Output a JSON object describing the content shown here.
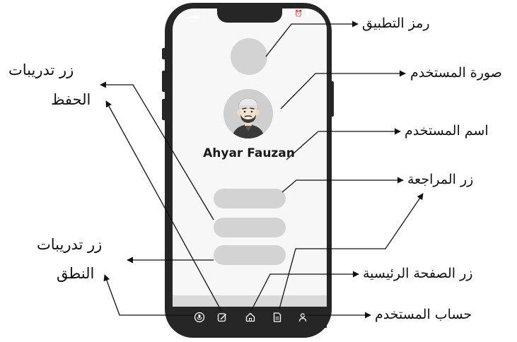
{
  "phone": {
    "user_name": "Ahyar Fauzan"
  },
  "labels": {
    "app_icon": "رمز التطبيق",
    "user_photo": "صورة المستخدم",
    "user_name": "اسم المستخدم",
    "review_button": "زر المراجعة",
    "home_button": "زر الصفحة الرئيسية",
    "user_account": "حساب المستخدم",
    "memorization_training_line1": "زر تدريبات",
    "memorization_training_line2": "الحفظ",
    "pronunciation_training_line1": "زر تدريبات",
    "pronunciation_training_line2": "النطق"
  },
  "nav_icons": [
    "mic-icon",
    "edit-icon",
    "home-icon",
    "document-icon",
    "user-icon"
  ],
  "colors": {
    "phone_body": "#262626",
    "screen": "#f7f7f7",
    "placeholder": "#d3d3d3",
    "ink": "#111111"
  }
}
